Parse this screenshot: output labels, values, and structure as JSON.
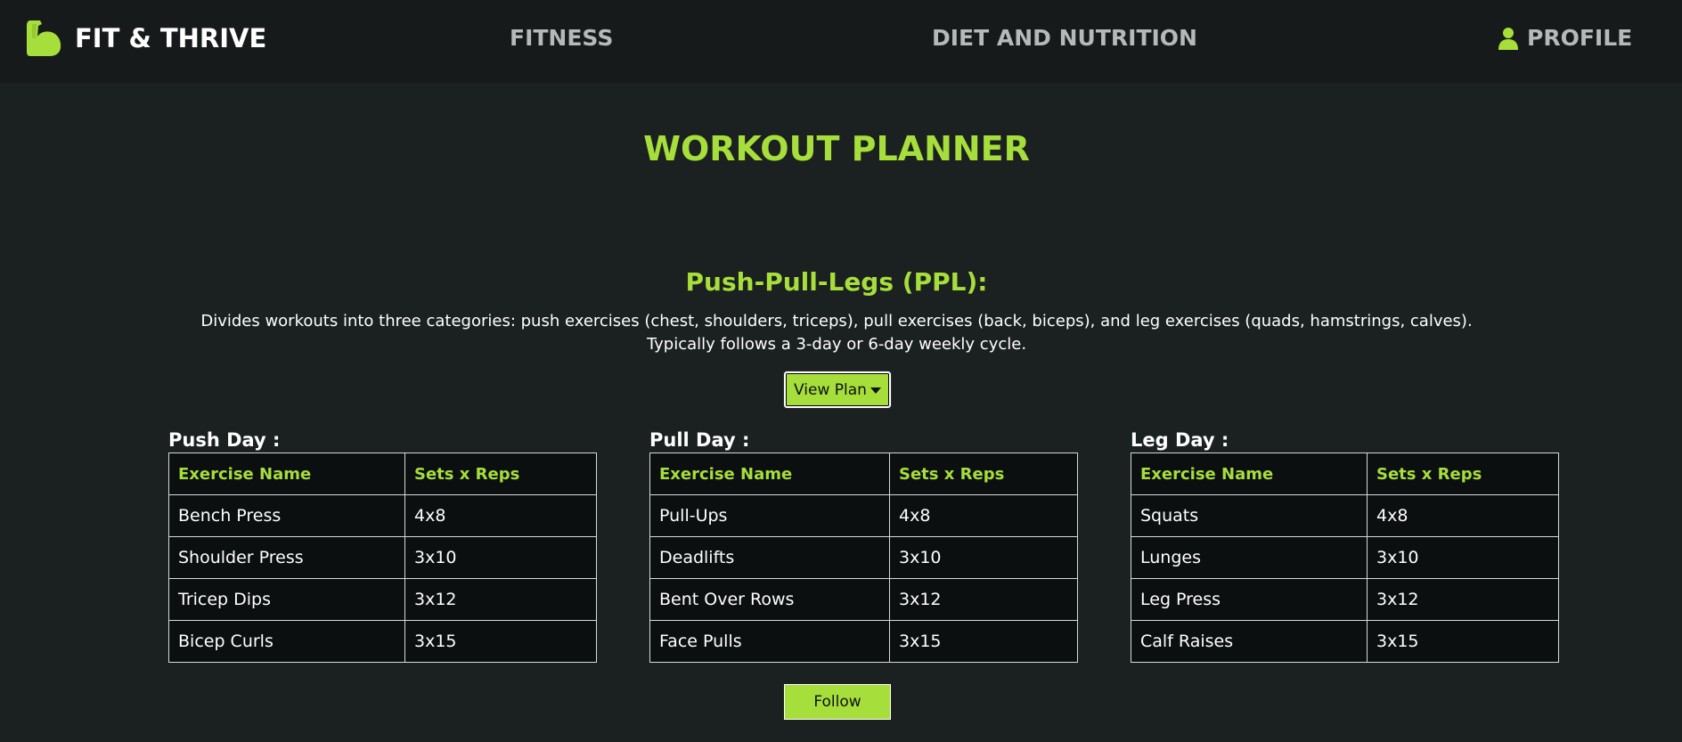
{
  "nav": {
    "brand": "FIT & THRIVE",
    "fitness": "FITNESS",
    "diet": "DIET AND NUTRITION",
    "profile": "PROFILE",
    "brand_icon": "flexed-arm-icon",
    "profile_icon": "user-icon"
  },
  "colors": {
    "accent": "#a6de3b",
    "background": "#1b2020",
    "navbar": "#161a1a",
    "table_bg": "#0b0f0f"
  },
  "page_title": "WORKOUT PLANNER",
  "plan": {
    "heading": "Push-Pull-Legs (PPL):",
    "description_line1": "Divides workouts into three categories: push exercises (chest, shoulders, triceps), pull exercises (back, biceps), and leg exercises (quads, hamstrings, calves).",
    "description_line2": "Typically follows a 3-day or 6-day weekly cycle.",
    "view_plan_label": "View Plan"
  },
  "days": [
    {
      "title": "Push Day :",
      "headers": [
        "Exercise Name",
        "Sets x Reps"
      ],
      "rows": [
        [
          "Bench Press",
          "4x8"
        ],
        [
          "Shoulder Press",
          "3x10"
        ],
        [
          "Tricep Dips",
          "3x12"
        ],
        [
          "Bicep Curls",
          "3x15"
        ]
      ]
    },
    {
      "title": "Pull Day :",
      "headers": [
        "Exercise Name",
        "Sets x Reps"
      ],
      "rows": [
        [
          "Pull-Ups",
          "4x8"
        ],
        [
          "Deadlifts",
          "3x10"
        ],
        [
          "Bent Over Rows",
          "3x12"
        ],
        [
          "Face Pulls",
          "3x15"
        ]
      ]
    },
    {
      "title": "Leg Day :",
      "headers": [
        "Exercise Name",
        "Sets x Reps"
      ],
      "rows": [
        [
          "Squats",
          "4x8"
        ],
        [
          "Lunges",
          "3x10"
        ],
        [
          "Leg Press",
          "3x12"
        ],
        [
          "Calf Raises",
          "3x15"
        ]
      ]
    }
  ],
  "follow_label": "Follow"
}
